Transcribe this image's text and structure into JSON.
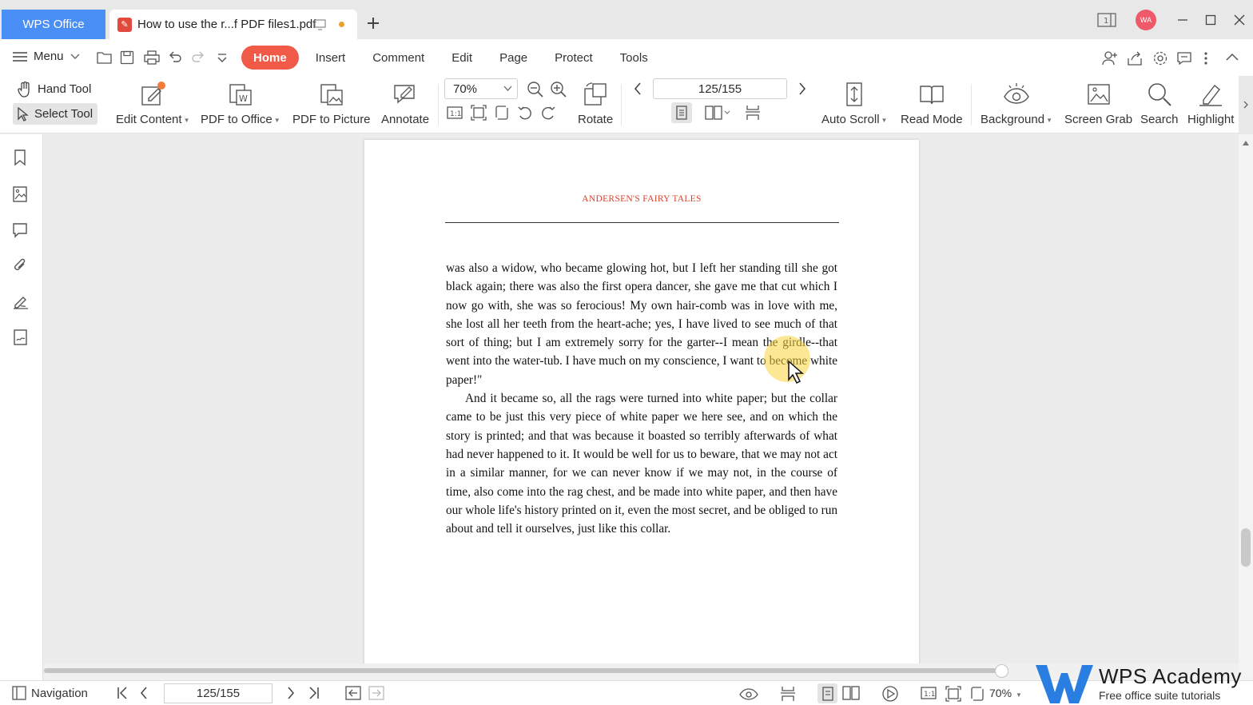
{
  "titlebar": {
    "app_tab": "WPS Office",
    "doc_tab": "How to use the r...f PDF files1.pdf",
    "avatar": "WA"
  },
  "menubar": {
    "menu_label": "Menu",
    "tabs": [
      "Home",
      "Insert",
      "Comment",
      "Edit",
      "Page",
      "Protect",
      "Tools"
    ],
    "active_tab": "Home"
  },
  "ribbon": {
    "hand_tool": "Hand Tool",
    "select_tool": "Select Tool",
    "edit_content": "Edit Content",
    "pdf_to_office": "PDF to Office",
    "pdf_to_picture": "PDF to Picture",
    "annotate": "Annotate",
    "zoom_value": "70%",
    "rotate": "Rotate",
    "page_value": "125/155",
    "auto_scroll": "Auto Scroll",
    "read_mode": "Read Mode",
    "background": "Background",
    "screen_grab": "Screen Grab",
    "search": "Search",
    "highlight": "Highlight"
  },
  "document": {
    "header": "ANDERSEN'S FAIRY TALES",
    "paragraphs": [
      "was also a widow, who became glowing hot, but I left her standing till she got black again; there was also the first opera dancer, she gave me that cut which I now go with, she was so ferocious! My own hair-comb was in love with me, she lost all her teeth from the heart-ache; yes, I have lived to see much of that sort of thing; but I am extremely sorry for the garter--I mean the girdle--that went into the water-tub. I have much on my conscience, I want to become white paper!\"",
      "And it became so, all the rags were turned into white paper; but the collar came to be just this very piece of white paper we here see, and on which the story is printed; and that was because it boasted so terribly afterwards of what had never happened to it. It would be well for us to beware, that we may not act in a similar manner, for we can never know if we may not, in the course of time, also come into the rag chest, and be made into white paper, and then have our whole life's history printed on it, even the most secret, and be obliged to run about and tell it ourselves, just like this collar."
    ]
  },
  "statusbar": {
    "navigation": "Navigation",
    "page_value": "125/155",
    "zoom_value": "70%"
  },
  "watermark": {
    "title": "WPS Academy",
    "subtitle": "Free office suite tutorials"
  },
  "colors": {
    "accent_red": "#f05a46",
    "wps_blue": "#4a8ff5",
    "header_red": "#d9432e"
  }
}
